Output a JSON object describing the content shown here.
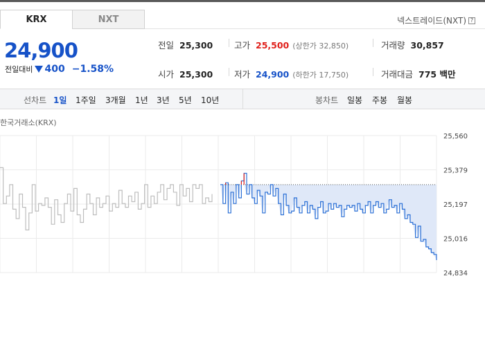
{
  "tabs": [
    {
      "label": "KRX",
      "active": true
    },
    {
      "label": "NXT",
      "active": false
    }
  ],
  "nxt_link": "넥스트레이드(NXT)",
  "help_icon": "?",
  "price": {
    "current": "24,900",
    "change_label": "전일대비",
    "change_value": "400",
    "change_pct": "−1.58%",
    "direction_icon": "down-triangle-icon",
    "color": "#1652c8"
  },
  "stats": {
    "prev": {
      "label": "전일",
      "value": "25,300"
    },
    "open": {
      "label": "시가",
      "value": "25,300"
    },
    "high": {
      "label": "고가",
      "value": "25,500",
      "sub": "(상한가 32,850)"
    },
    "low": {
      "label": "저가",
      "value": "24,900",
      "sub": "(하한가 17,750)"
    },
    "volume": {
      "label": "거래량",
      "value": "30,857"
    },
    "amount": {
      "label": "거래대금",
      "value": "775 백만"
    }
  },
  "toolbar": {
    "line_chart_label": "선차트",
    "periods": [
      "1일",
      "1주일",
      "3개월",
      "1년",
      "3년",
      "5년",
      "10년"
    ],
    "active_period": "1일",
    "candle_chart_label": "봉차트",
    "candles": [
      "일봉",
      "주봉",
      "월봉"
    ]
  },
  "chart_data": {
    "type": "line",
    "title": "한국거래소(KRX)",
    "y_ticks": [
      "25,560",
      "25,379",
      "25,197",
      "25,016",
      "24,834"
    ],
    "ylim": [
      24834,
      25560
    ],
    "prev_close": 25300,
    "colors": {
      "pre_market": "#bdbdbd",
      "above_prev": "#e0201b",
      "below_prev": "#2a6fd6",
      "fill": "#dfe8f8"
    },
    "series": [
      {
        "values": [
          25390,
          25200,
          25240,
          25300,
          25170,
          25120,
          25250,
          25180,
          25060,
          25150,
          25300,
          25160,
          25200,
          25190,
          25230,
          25180,
          25090,
          25220,
          25140,
          25100,
          25200,
          25250,
          25160,
          25280,
          25140,
          25100,
          25170,
          25250,
          25200,
          25140,
          25230,
          25180,
          25200,
          25240,
          25160,
          25200,
          25180,
          25270,
          25200,
          25180,
          25240,
          25210,
          25260,
          25170,
          25200,
          25300,
          25180,
          25240,
          25200,
          25260,
          25300,
          25220,
          25280,
          25300,
          25260,
          25190,
          25300,
          25240,
          25280,
          25210,
          25300,
          25280,
          25300,
          25200,
          25230,
          25210,
          25250
        ]
      },
      {
        "values": [
          25300,
          25200,
          25310,
          25150,
          25260,
          25200,
          25300,
          25230,
          25320,
          25360,
          25250,
          25300,
          25230,
          25200,
          25270,
          25240,
          25150,
          25260,
          25250,
          25300,
          25240,
          25280,
          25200,
          25140,
          25250,
          25190,
          25150,
          25160,
          25230,
          25180,
          25150,
          25190,
          25210,
          25150,
          25190,
          25170,
          25120,
          25180,
          25210,
          25150,
          25160,
          25200,
          25170,
          25200,
          25180,
          25190,
          25130,
          25170,
          25190,
          25180,
          25190,
          25160,
          25200,
          25170,
          25150,
          25190,
          25210,
          25150,
          25190,
          25210,
          25180,
          25200,
          25150,
          25170,
          25220,
          25180,
          25190,
          25150,
          25200,
          25170,
          25120,
          25140,
          25100,
          25090,
          25020,
          25080,
          25000,
          25010,
          24970,
          24960,
          24940,
          24930,
          24900
        ]
      }
    ]
  }
}
